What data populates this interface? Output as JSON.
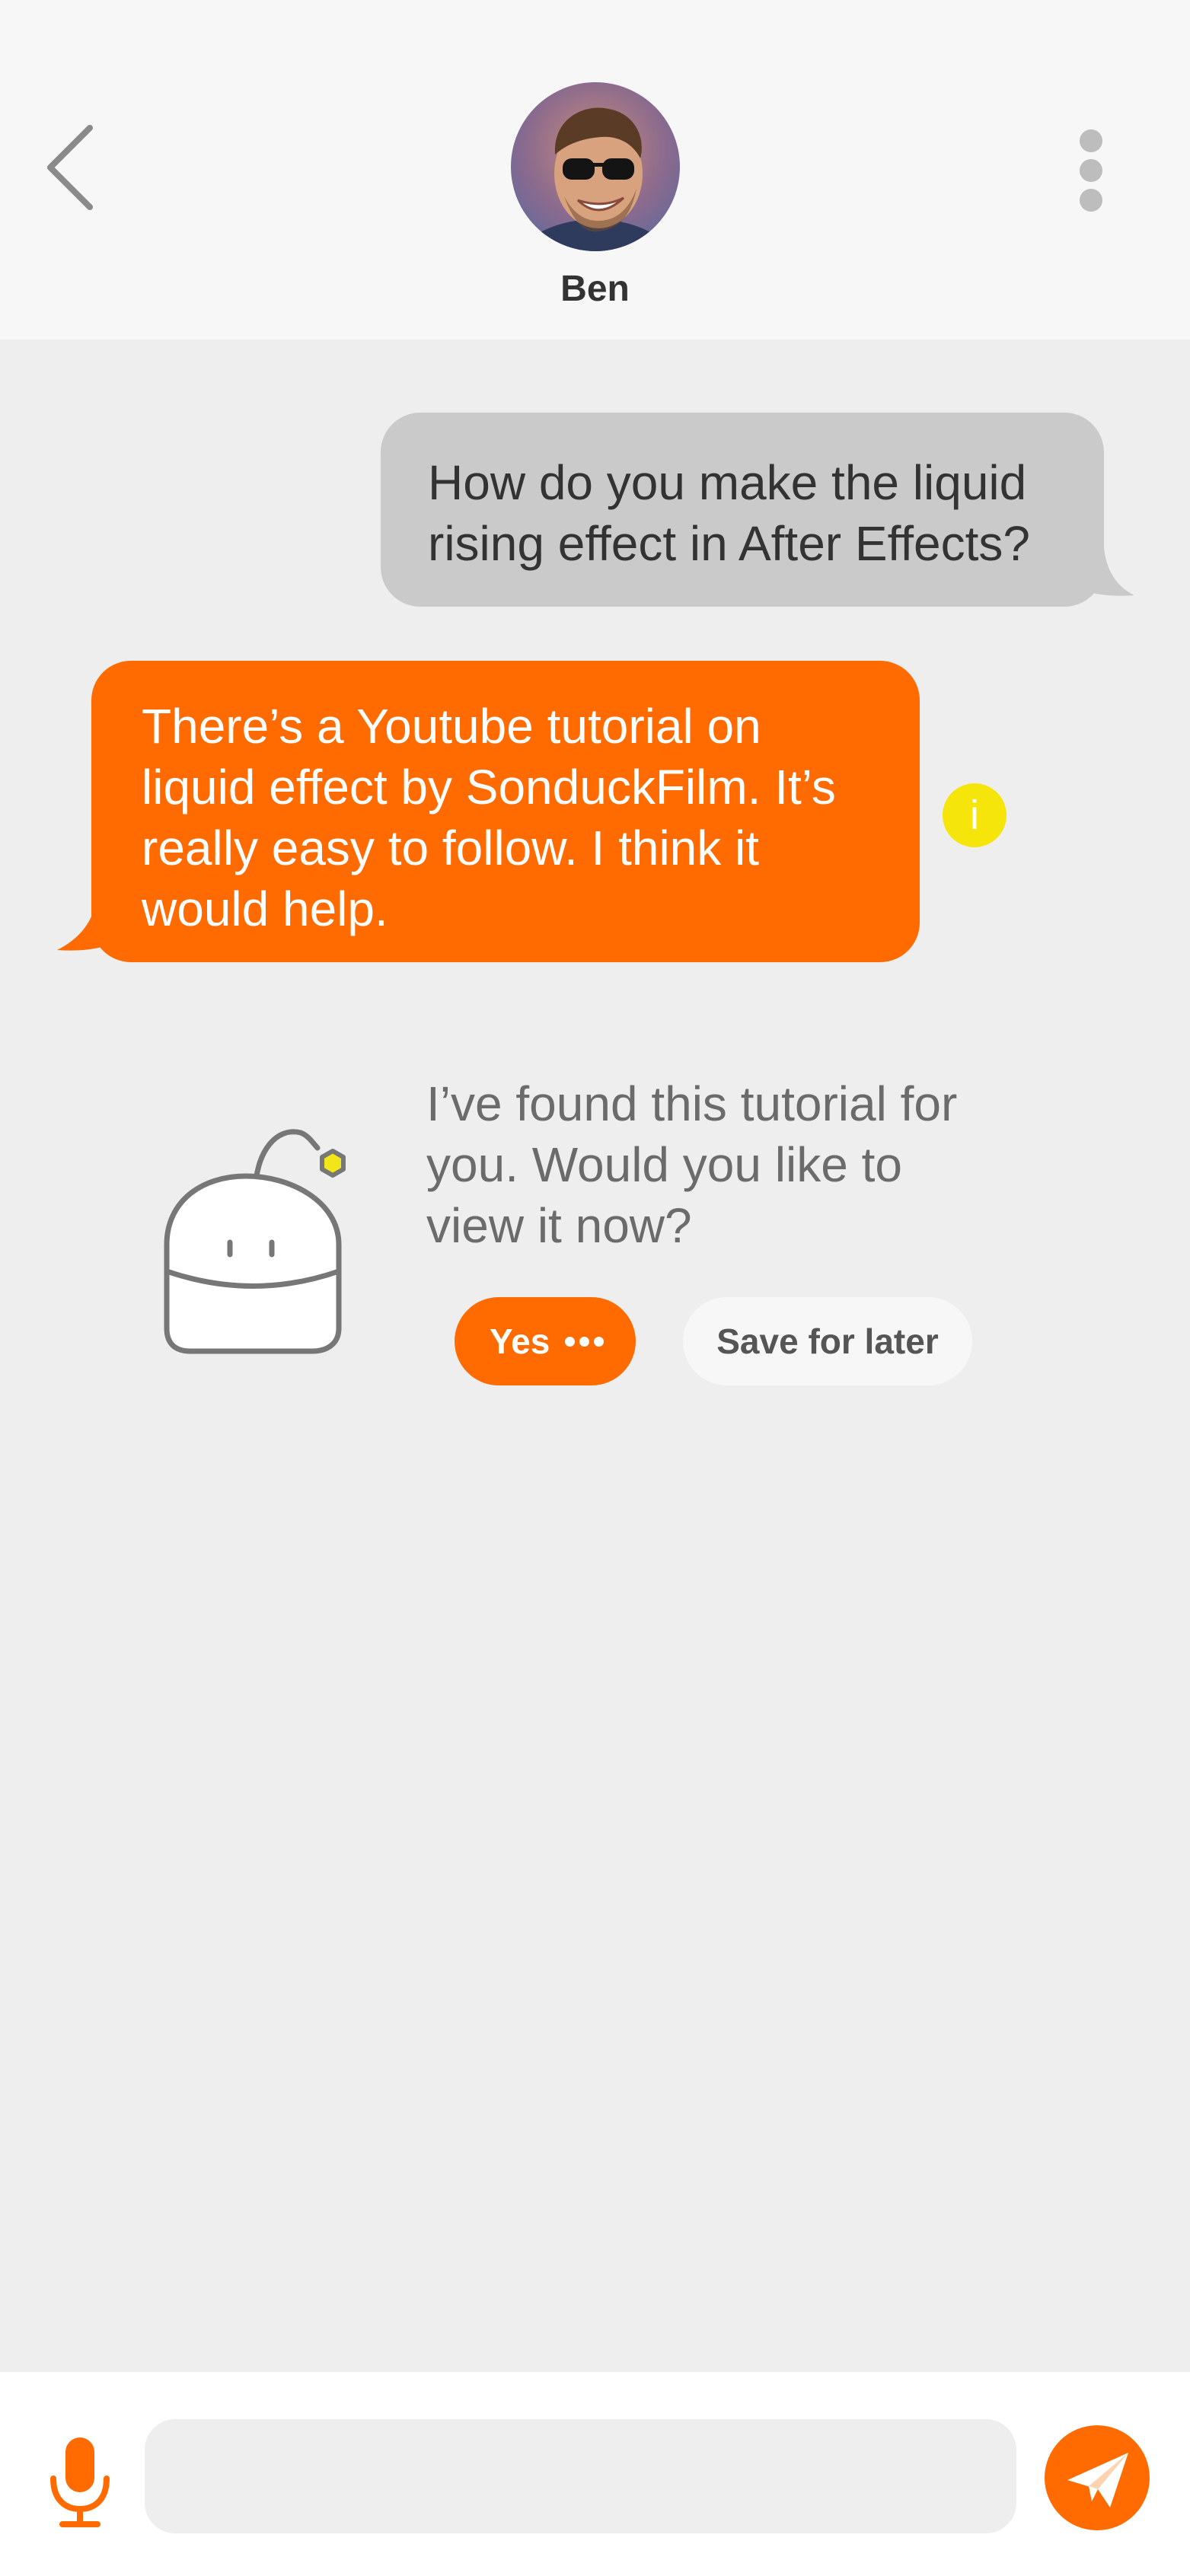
{
  "header": {
    "contact_name": "Ben",
    "back_icon": "chevron-left-icon",
    "more_icon": "more-vertical-icon"
  },
  "messages": [
    {
      "direction": "incoming",
      "text_lines": [
        "How do you make the liquid",
        "rising effect in After Effects?"
      ]
    },
    {
      "direction": "outgoing",
      "text_lines": [
        "There’s a Youtube tutorial on",
        "liquid effect by SonduckFilm. It’s",
        "really easy to follow. I think it",
        "would help."
      ],
      "info_icon": "i"
    }
  ],
  "assistant": {
    "text_lines": [
      "I’ve found this tutorial for",
      "you. Would you like to",
      "view it now?"
    ],
    "yes_label": "Yes",
    "later_label": "Save for later"
  },
  "composer": {
    "value": "",
    "placeholder": ""
  },
  "colors": {
    "accent": "#ff6b00",
    "info": "#f5e50a",
    "incoming_bubble": "#cacaca",
    "background": "#eeeeee"
  }
}
